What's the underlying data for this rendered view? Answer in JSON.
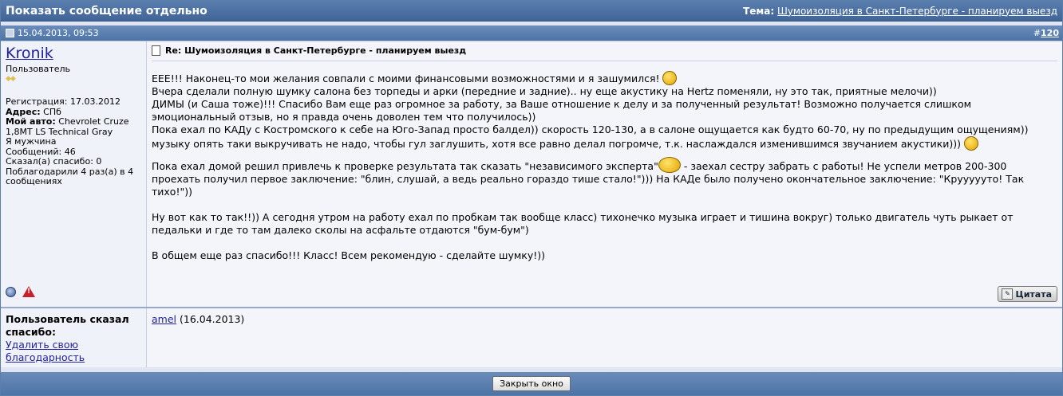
{
  "window": {
    "title": "Показать сообщение отдельно",
    "topic_label": "Тема:",
    "topic_link": "Шумоизоляция в Санкт-Петербурге - планируем выезд"
  },
  "post": {
    "date": "15.04.2013, 09:53",
    "number_prefix": "#",
    "number": "120",
    "title": "Re: Шумоизоляция в Санкт-Петербурге - планируем выезд",
    "paragraphs": {
      "p1": "ЕЕЕ!!! Наконец-то мои желания совпали с моими финансовыми возможностями и я зашумился!",
      "p2": "Вчера сделали полную шумку салона без торпеды и арки (передние и задние).. ну еще акустику на Hertz поменяли, ну это так, приятные мелочи))",
      "p3": "ДИМЫ (и Саша тоже)!!! Спасибо Вам еще раз огромное за работу, за Ваше отношение к делу и за полученный результат! Возможно получается слишком эмоциональный отзыв, но я правда очень доволен тем что получилось))",
      "p4": "Пока ехал по КАДу с Костромского к себе на Юго-Запад просто балдел)) скорость 120-130, а в салоне ощущается как будто 60-70, ну по предыдущим ощущениям)) музыку опять таки выкручивать не надо, чтобы гул заглушить, хотя все равно делал погромче, т.к. наслаждался изменившимся звучанием акустики)))",
      "p5a": "Пока ехал домой решил привлечь к проверке результата так сказать \"независимого эксперта\"",
      "p5b": " - заехал сестру забрать с работы! Не успели метров 200-300 проехать получил первое заключение: \"блин, слушай, а ведь реально гораздо тише стало!\"))) На КАДе было получено окончательное заключение: \"Круууууто! Так тихо!\"))",
      "p6": "Ну вот как то так!!)) А сегодня утром на работу ехал по пробкам так вообще класс) тихонечко музыка играет и тишина вокруг) только двигатель чуть рыкает от педальки и где то там далеко сколы на асфальте отдаются \"бум-бум\")",
      "p7": "В общем еще раз спасибо!!! Класс! Всем рекомендую - сделайте шумку!))"
    },
    "quote_label": "Цитата"
  },
  "user": {
    "name": "Kronik",
    "rank": "Пользователь",
    "reg": "Регистрация: 17.03.2012",
    "addr_label": "Адрес:",
    "addr": "СПб",
    "car_label": "Мой авто:",
    "car": "Chevrolet Cruze 1,8MT LS Technical Gray",
    "gender": "Я мужчина",
    "posts": "Сообщений: 46",
    "thanked": "Сказал(а) спасибо: 0",
    "thanks_recv": "Поблагодарили 4 раз(а) в 4 сообщениях"
  },
  "thanks": {
    "label": "Пользователь сказал спасибо:",
    "remove_link": "Удалить свою благодарность",
    "user": "amel",
    "date": "(16.04.2013)"
  },
  "footer": {
    "close_button": "Закрыть окно"
  },
  "colors": {
    "header": "#4a70a2",
    "link": "#22229c",
    "panel_bg": "#f4f5fb"
  }
}
